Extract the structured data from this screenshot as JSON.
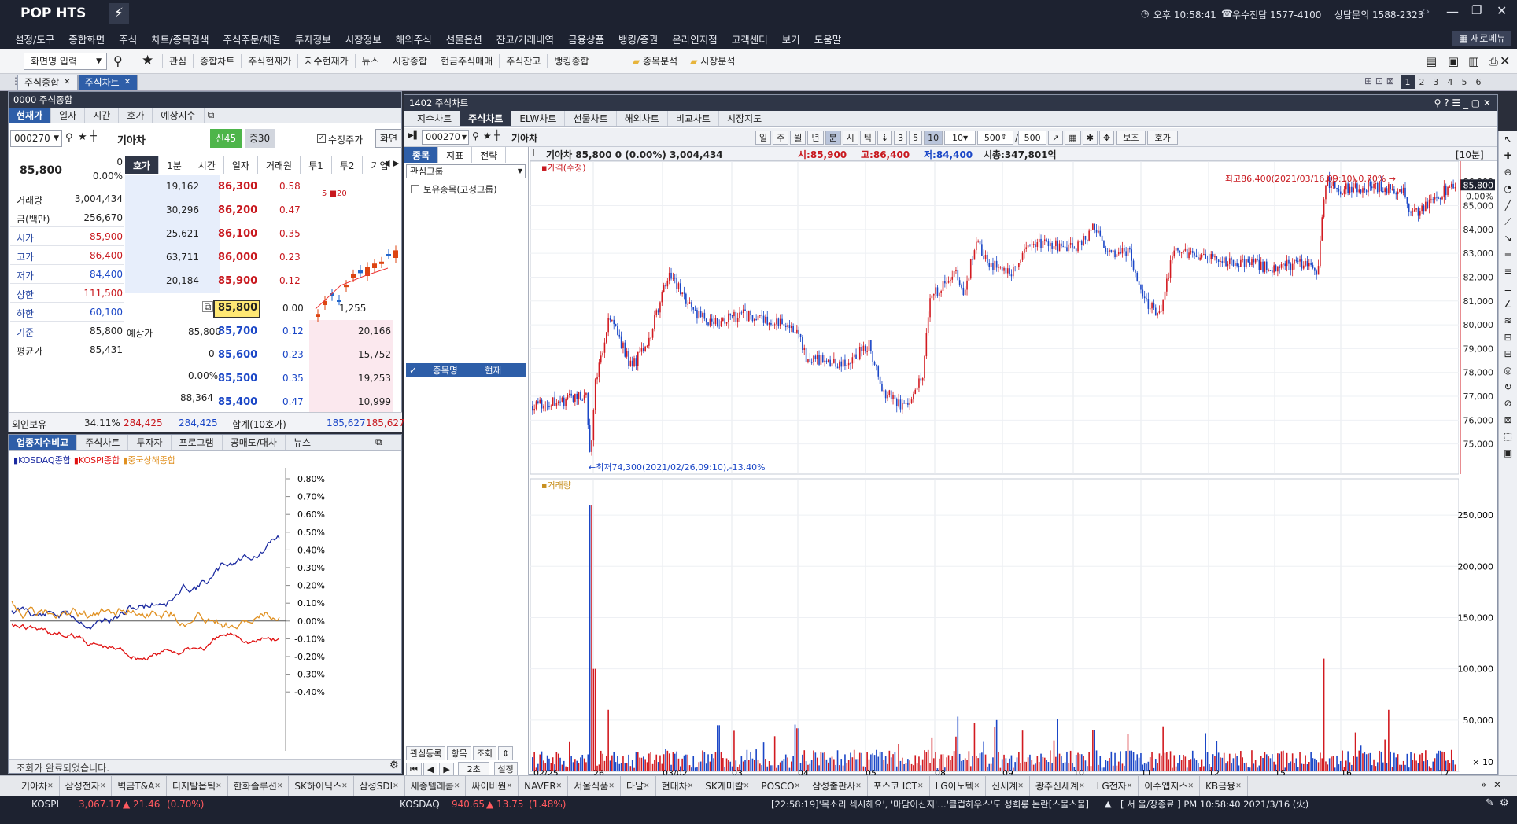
{
  "app": {
    "logo": "POP HTS",
    "time": "오후 10:58:41",
    "phone": "우수전담 1577-4100",
    "phone2": "상담문의 1588-2323"
  },
  "menu": [
    "설정/도구",
    "종합화면",
    "주식",
    "차트/종목검색",
    "주식주문/체결",
    "투자정보",
    "시장정보",
    "해외주식",
    "선물옵션",
    "잔고/거래내역",
    "금융상품",
    "뱅킹/증권",
    "온라인지점",
    "고객센터",
    "보기",
    "도움말"
  ],
  "new_menu": "새로메뉴",
  "toolbar": {
    "screen_input": "화면명 입력",
    "items": [
      "관심",
      "종합차트",
      "주식현재가",
      "지수현재가",
      "뉴스",
      "시장종합",
      "현금주식매매",
      "주식잔고",
      "뱅킹종합"
    ],
    "folders": [
      "종목분석",
      "시장분석"
    ],
    "pages": [
      "1",
      "2",
      "3",
      "4",
      "5",
      "6"
    ]
  },
  "window_tabs": [
    "주식종합",
    "주식차트"
  ],
  "left_panel": {
    "title": "0000 주식종합",
    "tabs": [
      "현재가",
      "일자",
      "시간",
      "호가",
      "예상지수"
    ],
    "code": "000270",
    "name": "기아차",
    "badge1": "신45",
    "badge2": "증30",
    "adj_label": "수정주가",
    "order_btn": "화면",
    "price": "85,800",
    "change": "0",
    "change_pct": "0.00%",
    "info": [
      {
        "label": "거래량",
        "value": "3,004,434"
      },
      {
        "label": "금(백만)",
        "value": "256,670"
      },
      {
        "label": "시가",
        "value": "85,900"
      },
      {
        "label": "고가",
        "value": "86,400"
      },
      {
        "label": "저가",
        "value": "84,400"
      },
      {
        "label": "상한",
        "value": "111,500"
      },
      {
        "label": "하한",
        "value": "60,100"
      },
      {
        "label": "기준",
        "value": "85,800"
      },
      {
        "label": "평균가",
        "value": "85,431"
      }
    ],
    "hoga_tabs": [
      "호가",
      "1분",
      "시간",
      "일자",
      "거래원",
      "투1",
      "투2",
      "기업"
    ],
    "ask": [
      {
        "qty": "19,162",
        "price": "86,300",
        "pct": "0.58"
      },
      {
        "qty": "30,296",
        "price": "86,200",
        "pct": "0.47"
      },
      {
        "qty": "25,621",
        "price": "86,100",
        "pct": "0.35"
      },
      {
        "qty": "63,711",
        "price": "86,000",
        "pct": "0.23"
      },
      {
        "qty": "20,184",
        "price": "85,900",
        "pct": "0.12"
      }
    ],
    "current": {
      "price": "85,800",
      "pct": "0.00",
      "vol": "1,255"
    },
    "bid": [
      {
        "price": "85,700",
        "pct": "0.12",
        "qty": "20,166"
      },
      {
        "price": "85,600",
        "pct": "0.23",
        "qty": "15,752"
      },
      {
        "price": "85,500",
        "pct": "0.35",
        "qty": "19,253"
      },
      {
        "price": "85,400",
        "pct": "0.47",
        "qty": "10,999"
      }
    ],
    "expect": {
      "label": "예상가",
      "price": "85,800",
      "zero": "0",
      "pct": "0.00%",
      "qty": "88,364"
    },
    "foreign": {
      "label": "외인보유",
      "pct": "34.11%",
      "v1": "284,425",
      "v2": "284,425",
      "total_label": "합계(10호가)",
      "t1": "185,627",
      "t2": "185,627"
    },
    "mini_legend": "5 ■20"
  },
  "compare_panel": {
    "tabs": [
      "업종지수비교",
      "주식차트",
      "투자자",
      "프로그램",
      "공매도/대차",
      "뉴스"
    ],
    "legend": [
      "KOSDAQ종합",
      "KOSPI종합",
      "중국상해종합"
    ],
    "yticks": [
      "0.80%",
      "0.70%",
      "0.60%",
      "0.50%",
      "0.40%",
      "0.30%",
      "0.20%",
      "0.10%",
      "0.00%",
      "-0.10%",
      "-0.20%",
      "-0.30%",
      "-0.40%"
    ],
    "status": "조회가 완료되었습니다."
  },
  "chart_panel": {
    "title": "1402 주식차트",
    "tabs": [
      "지수차트",
      "주식차트",
      "ELW차트",
      "선물차트",
      "해외차트",
      "비교차트",
      "시장지도"
    ],
    "code": "000270",
    "name": "기아차",
    "periods": [
      "일",
      "주",
      "월",
      "년",
      "분",
      "시",
      "틱"
    ],
    "nums": [
      "3",
      "5",
      "10"
    ],
    "interval": "10",
    "count": "500",
    "count2": "500",
    "btn_assist": "보조",
    "btn_hoga": "호가",
    "side_tabs": [
      "종목",
      "지표",
      "전략"
    ],
    "group": "관심그룹",
    "group_item": "보유종목(고정그룹)",
    "list_cols": [
      "종목명",
      "현재"
    ],
    "side_btns": [
      "관심등록",
      "항목",
      "조회"
    ],
    "speed": "2초",
    "setting": "설정",
    "info_line": "기아차  85,800  0 (0.00%)  3,004,434",
    "info_open": "시:85,900",
    "info_high": "고:86,400",
    "info_low": "저:84,400",
    "info_cap": "시총:347,801억",
    "period_label": "[10분]",
    "price_label": "가격(수정)",
    "vol_label": "거래량",
    "max_note": "최고86,400(2021/03/16,09:10),0.70%",
    "min_note": "최저74,300(2021/02/26,09:10),-13.40%",
    "price_ticks": [
      "86,000",
      "85,800",
      "0.00%",
      "85,000",
      "84,000",
      "83,000",
      "82,000",
      "81,000",
      "80,000",
      "79,000",
      "78,000",
      "77,000",
      "76,000",
      "75,000"
    ],
    "vol_ticks": [
      "250,000",
      "200,000",
      "150,000",
      "100,000",
      "50,000",
      "× 10"
    ],
    "x_labels": [
      "02/25",
      "26",
      "03/02",
      "03",
      "04",
      "05",
      "08",
      "09",
      "10",
      "11",
      "12",
      "15",
      "16",
      "17"
    ]
  },
  "tickers": [
    "기아차",
    "삼성전자",
    "벽금T&A",
    "디지탈옵틱",
    "한화솔루션",
    "SK하이닉스",
    "삼성SDI",
    "세종텔레콤",
    "싸이버원",
    "NAVER",
    "서울식품",
    "다날",
    "현대차",
    "SK케미칼",
    "POSCO",
    "삼성출판사",
    "포스코 ICT",
    "LG이노텍",
    "신세계",
    "광주신세계",
    "LG전자",
    "이수앱지스",
    "KB금융"
  ],
  "status": {
    "kospi_label": "KOSPI",
    "kospi": "3,067.17",
    "kospi_chg": "▲ 21.46",
    "kospi_pct": "(0.70%)",
    "kosdaq_label": "KOSDAQ",
    "kosdaq": "940.65",
    "kosdaq_chg": "▲ 13.75",
    "kosdaq_pct": "(1.48%)",
    "news": "[22:58:19]'목소리 섹시해요', '마담이신지'…'클럽하우스'도 성희롱 논란[스물스물]",
    "clock": "[ 서  울/장종료 ] PM 10:58:40  2021/3/16 (火)"
  },
  "colors": {
    "up": "#c8181e",
    "down": "#1b47c7",
    "header": "#1d2230",
    "accent": "#2e5ea8"
  }
}
